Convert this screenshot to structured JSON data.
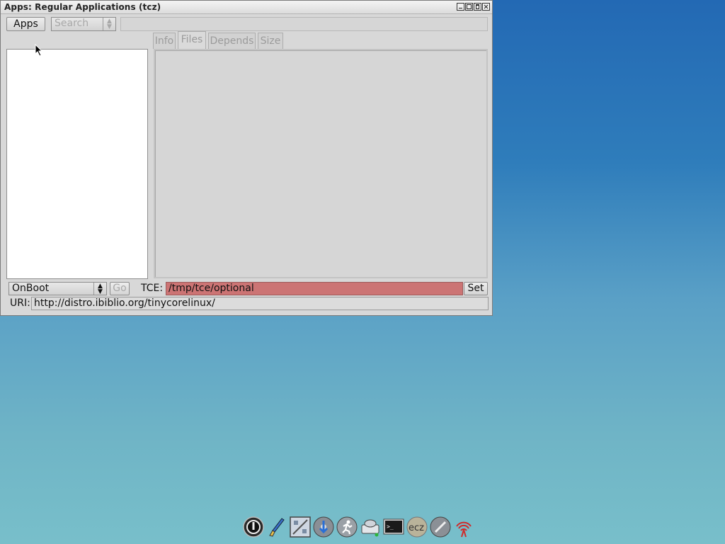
{
  "window": {
    "title": "Apps: Regular Applications (tcz)",
    "controls": [
      "minimize",
      "maximize",
      "restore",
      "close"
    ]
  },
  "toolbar": {
    "apps_label": "Apps",
    "search_label": "Search",
    "search_value": ""
  },
  "tabs": [
    "Info",
    "Files",
    "Depends",
    "Size"
  ],
  "bottom": {
    "mode_value": "OnBoot",
    "go_label": "Go",
    "tce_label": "TCE:",
    "tce_value": "/tmp/tce/optional",
    "set_label": "Set",
    "uri_label": "URI:",
    "uri_value": "http://distro.ibiblio.org/tinycorelinux/"
  },
  "dock": {
    "icons": [
      "power-icon",
      "paint-brush-icon",
      "control-panel-icon",
      "install-icon",
      "run-icon",
      "mount-icon",
      "terminal-icon",
      "ecz-icon",
      "tools-icon",
      "wifi-icon"
    ],
    "ecz_text": "ecz"
  },
  "colors": {
    "tce_field_bg": "#cc7474",
    "desktop_top": "#2369b4",
    "desktop_bottom": "#78bfca"
  }
}
